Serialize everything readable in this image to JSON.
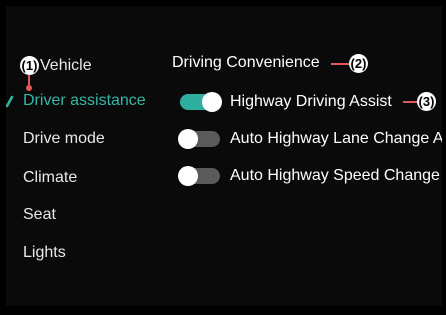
{
  "sidebar": {
    "items": [
      {
        "label": "Vehicle"
      },
      {
        "label": "Driver assistance",
        "active": true
      },
      {
        "label": "Drive mode"
      },
      {
        "label": "Climate"
      },
      {
        "label": "Seat"
      },
      {
        "label": "Lights"
      }
    ]
  },
  "section": {
    "title": "Driving Convenience"
  },
  "toggles": [
    {
      "label": "Highway Driving Assist",
      "state": "on"
    },
    {
      "label": "Auto Highway Lane Change As",
      "state": "off"
    },
    {
      "label": "Auto Highway Speed Change",
      "state": "off"
    }
  ],
  "callouts": {
    "c1": "(1)",
    "c2": "(2)",
    "c3": "(3)"
  },
  "colors": {
    "accent": "#2eae9f",
    "callout_line": "#e25a5a",
    "background": "#0a0a0a"
  }
}
